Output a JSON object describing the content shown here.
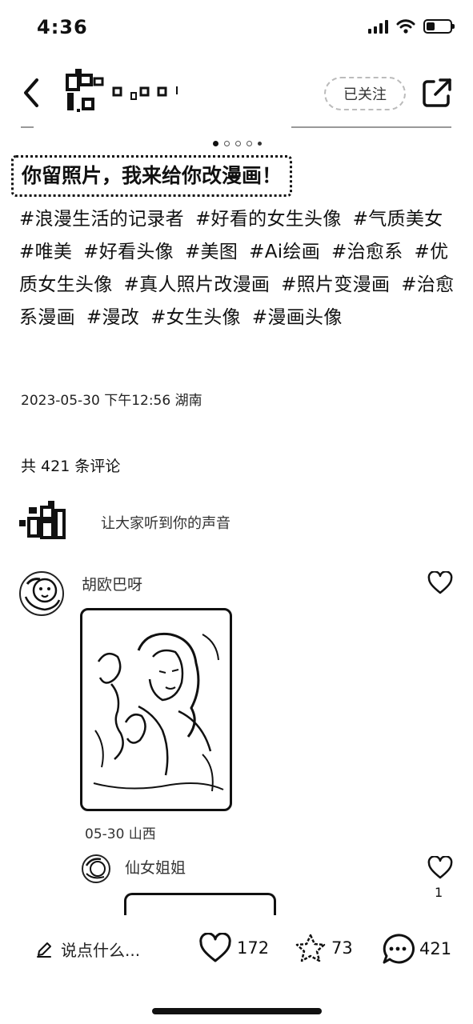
{
  "status_bar": {
    "time": "4:36"
  },
  "header": {
    "follow_label": "已关注"
  },
  "carousel": {
    "total_dots": 5,
    "active_index": 0
  },
  "post": {
    "title": "你留照片，我来给你改漫画！",
    "tags": [
      "#浪漫生活的记录者",
      "#好看的女生头像",
      "#气质美女",
      "#唯美",
      "#好看头像",
      "#美图",
      "#Ai绘画",
      "#治愈系",
      "#优质女生头像",
      "#真人照片改漫画",
      "#照片变漫画",
      "#治愈系漫画",
      "#漫改",
      "#女生头像",
      "#漫画头像"
    ],
    "meta": "2023-05-30 下午12:56 湖南"
  },
  "comments": {
    "count_label": "共 421 条评论",
    "input_hint": "让大家听到你的声音",
    "items": [
      {
        "name": "胡欧巴呀",
        "meta": "05-30 山西"
      }
    ],
    "reply": {
      "name": "仙女姐姐",
      "like_count": "1"
    }
  },
  "bottom_bar": {
    "comment_placeholder": "说点什么...",
    "likes": "172",
    "collects": "73",
    "comments": "421"
  },
  "icons": {
    "back": "chevron-left-icon",
    "share": "share-icon",
    "like": "heart-icon",
    "collect": "star-icon",
    "comment": "chat-bubble-icon",
    "edit": "pencil-icon"
  }
}
